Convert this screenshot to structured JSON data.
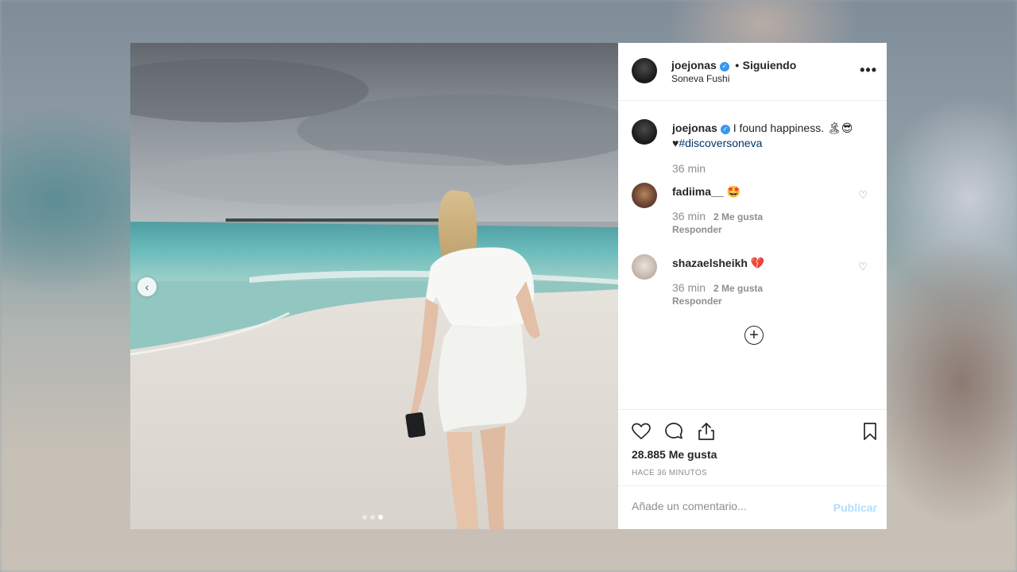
{
  "post": {
    "username": "joejonas",
    "follow_status": "Siguiendo",
    "separator": "•",
    "location": "Soneva Fushi",
    "more_glyph": "•••",
    "prev_glyph": "‹"
  },
  "caption": {
    "username": "joejonas",
    "text": "I found happiness. 🏝😎",
    "line2_prefix": "♥",
    "hashtag": "#discoversoneva",
    "time": "36 min"
  },
  "comments": [
    {
      "username": "fadiima__",
      "text": "🤩",
      "time": "36 min",
      "likes": "2 Me gusta",
      "reply": "Responder"
    },
    {
      "username": "shazaelsheikh",
      "text": "💔",
      "time": "36 min",
      "likes": "2 Me gusta",
      "reply": "Responder"
    }
  ],
  "load_more_glyph": "+",
  "stats": {
    "likes": "28.885 Me gusta",
    "time_ago": "HACE 36 MINUTOS"
  },
  "comment_box": {
    "placeholder": "Añade un comentario...",
    "publish_label": "Publicar"
  },
  "carousel": {
    "count": 3,
    "active_index": 2
  },
  "colors": {
    "link": "#003569",
    "verified": "#3897f0",
    "publish_disabled": "#b2dffc",
    "muted": "#8e8e8e"
  }
}
